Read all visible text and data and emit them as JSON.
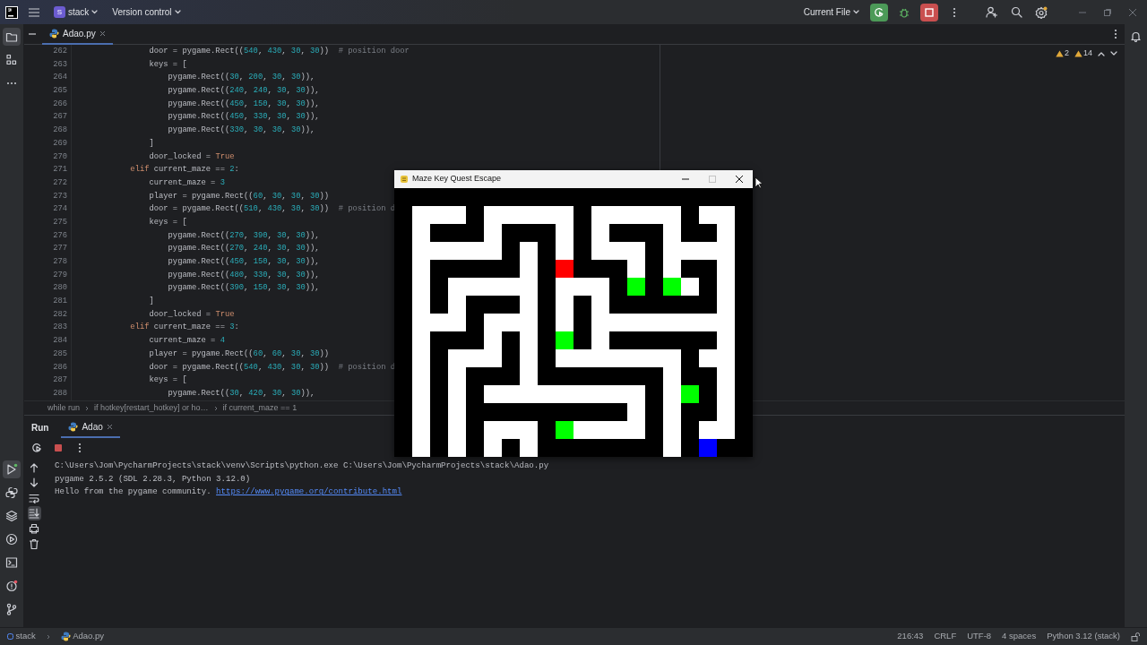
{
  "title_bar": {
    "project_initial": "S",
    "project": "stack",
    "vcs": "Version control",
    "run_config": "Current File"
  },
  "left_toolbar": {
    "top": [
      {
        "selected": true
      },
      {
        "selected": false
      },
      {
        "selected": false
      }
    ],
    "bottom": [
      {
        "selected": true
      },
      {
        "selected": false
      },
      {
        "selected": false
      },
      {
        "selected": false
      },
      {
        "selected": false
      },
      {
        "selected": false
      },
      {
        "selected": false
      }
    ]
  },
  "editor": {
    "tabs": [
      {
        "label": "Adao.py",
        "selected": true
      }
    ],
    "inspections": [
      "2",
      "14"
    ],
    "lines": [
      {
        "number": "262",
        "tokens": [
          {
            "text": "                door = pygame.Rect(("
          },
          {
            "text": "540",
            "kind": "number"
          },
          {
            "text": ", "
          },
          {
            "text": "430",
            "kind": "number"
          },
          {
            "text": ", "
          },
          {
            "text": "30",
            "kind": "number"
          },
          {
            "text": ", "
          },
          {
            "text": "30",
            "kind": "number"
          },
          {
            "text": "))  "
          },
          {
            "text": "# position door",
            "kind": "comment"
          }
        ]
      },
      {
        "number": "263",
        "tokens": [
          {
            "text": "                keys = ["
          }
        ]
      },
      {
        "number": "264",
        "tokens": [
          {
            "text": "                    pygame.Rect(("
          },
          {
            "text": "30",
            "kind": "number"
          },
          {
            "text": ", "
          },
          {
            "text": "200",
            "kind": "number"
          },
          {
            "text": ", "
          },
          {
            "text": "30",
            "kind": "number"
          },
          {
            "text": ", "
          },
          {
            "text": "30",
            "kind": "number"
          },
          {
            "text": ")),"
          }
        ]
      },
      {
        "number": "265",
        "tokens": [
          {
            "text": "                    pygame.Rect(("
          },
          {
            "text": "240",
            "kind": "number"
          },
          {
            "text": ", "
          },
          {
            "text": "240",
            "kind": "number"
          },
          {
            "text": ", "
          },
          {
            "text": "30",
            "kind": "number"
          },
          {
            "text": ", "
          },
          {
            "text": "30",
            "kind": "number"
          },
          {
            "text": ")),"
          }
        ]
      },
      {
        "number": "266",
        "tokens": [
          {
            "text": "                    pygame.Rect(("
          },
          {
            "text": "450",
            "kind": "number"
          },
          {
            "text": ", "
          },
          {
            "text": "150",
            "kind": "number"
          },
          {
            "text": ", "
          },
          {
            "text": "30",
            "kind": "number"
          },
          {
            "text": ", "
          },
          {
            "text": "30",
            "kind": "number"
          },
          {
            "text": ")),"
          }
        ]
      },
      {
        "number": "267",
        "tokens": [
          {
            "text": "                    pygame.Rect(("
          },
          {
            "text": "450",
            "kind": "number"
          },
          {
            "text": ", "
          },
          {
            "text": "330",
            "kind": "number"
          },
          {
            "text": ", "
          },
          {
            "text": "30",
            "kind": "number"
          },
          {
            "text": ", "
          },
          {
            "text": "30",
            "kind": "number"
          },
          {
            "text": ")),"
          }
        ]
      },
      {
        "number": "268",
        "tokens": [
          {
            "text": "                    pygame.Rect(("
          },
          {
            "text": "330",
            "kind": "number"
          },
          {
            "text": ", "
          },
          {
            "text": "30",
            "kind": "number"
          },
          {
            "text": ", "
          },
          {
            "text": "30",
            "kind": "number"
          },
          {
            "text": ", "
          },
          {
            "text": "30",
            "kind": "number"
          },
          {
            "text": ")),"
          }
        ]
      },
      {
        "number": "269",
        "tokens": [
          {
            "text": "                ]"
          }
        ]
      },
      {
        "number": "270",
        "tokens": [
          {
            "text": "                door_locked = "
          },
          {
            "text": "True",
            "kind": "keyword"
          }
        ]
      },
      {
        "number": "271",
        "tokens": [
          {
            "text": "            elif",
            "kind": "keyword"
          },
          {
            "text": " current_maze == "
          },
          {
            "text": "2",
            "kind": "number"
          },
          {
            "text": ":"
          }
        ]
      },
      {
        "number": "272",
        "tokens": [
          {
            "text": "                current_maze = "
          },
          {
            "text": "3",
            "kind": "number"
          }
        ]
      },
      {
        "number": "273",
        "tokens": [
          {
            "text": "                player = pygame.Rect(("
          },
          {
            "text": "60",
            "kind": "number"
          },
          {
            "text": ", "
          },
          {
            "text": "30",
            "kind": "number"
          },
          {
            "text": ", "
          },
          {
            "text": "30",
            "kind": "number"
          },
          {
            "text": ", "
          },
          {
            "text": "30",
            "kind": "number"
          },
          {
            "text": "))"
          }
        ]
      },
      {
        "number": "274",
        "tokens": [
          {
            "text": "                door = pygame.Rect(("
          },
          {
            "text": "510",
            "kind": "number"
          },
          {
            "text": ", "
          },
          {
            "text": "430",
            "kind": "number"
          },
          {
            "text": ", "
          },
          {
            "text": "30",
            "kind": "number"
          },
          {
            "text": ", "
          },
          {
            "text": "30",
            "kind": "number"
          },
          {
            "text": "))  "
          },
          {
            "text": "# position d",
            "kind": "comment"
          }
        ]
      },
      {
        "number": "275",
        "tokens": [
          {
            "text": "                keys = ["
          }
        ]
      },
      {
        "number": "276",
        "tokens": [
          {
            "text": "                    pygame.Rect(("
          },
          {
            "text": "270",
            "kind": "number"
          },
          {
            "text": ", "
          },
          {
            "text": "390",
            "kind": "number"
          },
          {
            "text": ", "
          },
          {
            "text": "30",
            "kind": "number"
          },
          {
            "text": ", "
          },
          {
            "text": "30",
            "kind": "number"
          },
          {
            "text": ")),"
          }
        ]
      },
      {
        "number": "277",
        "tokens": [
          {
            "text": "                    pygame.Rect(("
          },
          {
            "text": "270",
            "kind": "number"
          },
          {
            "text": ", "
          },
          {
            "text": "240",
            "kind": "number"
          },
          {
            "text": ", "
          },
          {
            "text": "30",
            "kind": "number"
          },
          {
            "text": ", "
          },
          {
            "text": "30",
            "kind": "number"
          },
          {
            "text": ")),"
          }
        ]
      },
      {
        "number": "278",
        "tokens": [
          {
            "text": "                    pygame.Rect(("
          },
          {
            "text": "450",
            "kind": "number"
          },
          {
            "text": ", "
          },
          {
            "text": "150",
            "kind": "number"
          },
          {
            "text": ", "
          },
          {
            "text": "30",
            "kind": "number"
          },
          {
            "text": ", "
          },
          {
            "text": "30",
            "kind": "number"
          },
          {
            "text": ")),"
          }
        ]
      },
      {
        "number": "279",
        "tokens": [
          {
            "text": "                    pygame.Rect(("
          },
          {
            "text": "480",
            "kind": "number"
          },
          {
            "text": ", "
          },
          {
            "text": "330",
            "kind": "number"
          },
          {
            "text": ", "
          },
          {
            "text": "30",
            "kind": "number"
          },
          {
            "text": ", "
          },
          {
            "text": "30",
            "kind": "number"
          },
          {
            "text": ")),"
          }
        ]
      },
      {
        "number": "280",
        "tokens": [
          {
            "text": "                    pygame.Rect(("
          },
          {
            "text": "390",
            "kind": "number"
          },
          {
            "text": ", "
          },
          {
            "text": "150",
            "kind": "number"
          },
          {
            "text": ", "
          },
          {
            "text": "30",
            "kind": "number"
          },
          {
            "text": ", "
          },
          {
            "text": "30",
            "kind": "number"
          },
          {
            "text": ")),"
          }
        ]
      },
      {
        "number": "281",
        "tokens": [
          {
            "text": "                ]"
          }
        ]
      },
      {
        "number": "282",
        "tokens": [
          {
            "text": "                door_locked = "
          },
          {
            "text": "True",
            "kind": "keyword"
          }
        ]
      },
      {
        "number": "283",
        "tokens": [
          {
            "text": "            elif",
            "kind": "keyword"
          },
          {
            "text": " current_maze == "
          },
          {
            "text": "3",
            "kind": "number"
          },
          {
            "text": ":"
          }
        ]
      },
      {
        "number": "284",
        "tokens": [
          {
            "text": "                current_maze = "
          },
          {
            "text": "4",
            "kind": "number"
          }
        ]
      },
      {
        "number": "285",
        "tokens": [
          {
            "text": "                player = pygame.Rect(("
          },
          {
            "text": "60",
            "kind": "number"
          },
          {
            "text": ", "
          },
          {
            "text": "60",
            "kind": "number"
          },
          {
            "text": ", "
          },
          {
            "text": "30",
            "kind": "number"
          },
          {
            "text": ", "
          },
          {
            "text": "30",
            "kind": "number"
          },
          {
            "text": "))"
          }
        ]
      },
      {
        "number": "286",
        "tokens": [
          {
            "text": "                door = pygame.Rect(("
          },
          {
            "text": "540",
            "kind": "number"
          },
          {
            "text": ", "
          },
          {
            "text": "430",
            "kind": "number"
          },
          {
            "text": ", "
          },
          {
            "text": "30",
            "kind": "number"
          },
          {
            "text": ", "
          },
          {
            "text": "30",
            "kind": "number"
          },
          {
            "text": "))  "
          },
          {
            "text": "# position d",
            "kind": "comment"
          }
        ]
      },
      {
        "number": "287",
        "tokens": [
          {
            "text": "                keys = ["
          }
        ]
      },
      {
        "number": "288",
        "tokens": [
          {
            "text": "                    pygame.Rect(("
          },
          {
            "text": "30",
            "kind": "number"
          },
          {
            "text": ", "
          },
          {
            "text": "420",
            "kind": "number"
          },
          {
            "text": ", "
          },
          {
            "text": "30",
            "kind": "number"
          },
          {
            "text": ", "
          },
          {
            "text": "30",
            "kind": "number"
          },
          {
            "text": ")),"
          }
        ]
      }
    ],
    "breadcrumbs": [
      "while run",
      "if hotkey[restart_hotkey] or ho…",
      "if current_maze == 1"
    ]
  },
  "run_panel": {
    "title": "Run",
    "tabs": [
      {
        "label": "Adao",
        "selected": true
      }
    ],
    "tools": [
      {
        "selected": false
      },
      {
        "selected": false
      },
      {
        "selected": false
      },
      {
        "selected": true
      },
      {
        "selected": false
      },
      {
        "selected": false
      }
    ],
    "console": [
      {
        "text": "C:\\Users\\Jom\\PycharmProjects\\stack\\venv\\Scripts\\python.exe C:\\Users\\Jom\\PycharmProjects\\stack\\Adao.py"
      },
      {
        "text": "pygame 2.5.2 (SDL 2.28.3, Python 3.12.0)"
      },
      {
        "text": "Hello from the pygame community. ",
        "link": "https://www.pygame.org/contribute.html"
      }
    ]
  },
  "game_window": {
    "title": "Maze Key Quest Escape"
  },
  "status_bar": {
    "path": [
      "stack",
      "Adao.py"
    ],
    "items": [
      "216:43",
      "CRLF",
      "UTF-8",
      "4 spaces",
      "Python 3.12 (stack)"
    ]
  }
}
